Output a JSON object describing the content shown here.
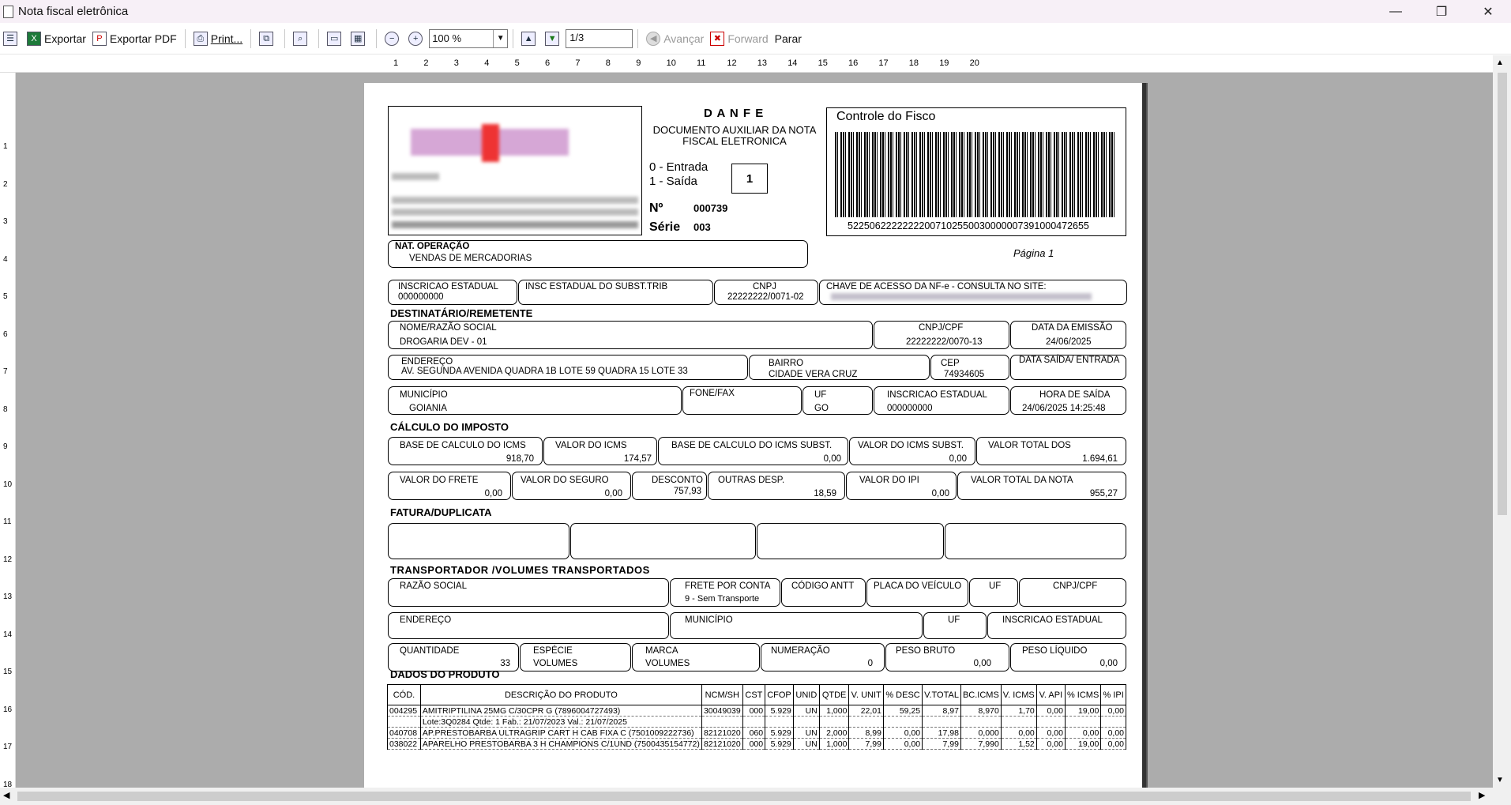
{
  "window": {
    "title": "Nota fiscal eletrônica",
    "min_glyph": "—",
    "max_glyph": "❐",
    "close_glyph": "✕"
  },
  "toolbar": {
    "export_label": "Exportar",
    "export_pdf_label": "Exportar PDF",
    "print_label": "Print...",
    "zoom_value": "100 %",
    "page_value": "1/3",
    "advance_label": "Avançar",
    "forward_label": "Forward",
    "stop_label": "Parar",
    "glyphs": {
      "toc": "☰",
      "xls": "X",
      "pdf": "P",
      "print": "⎙",
      "copy": "⧉",
      "find": "⌕",
      "single": "▭",
      "multi": "▦",
      "zoom_out": "−",
      "zoom_in": "+",
      "up": "▲",
      "down": "▼",
      "advance": "◀",
      "forward": "✖"
    }
  },
  "ruler": {
    "marks": [
      "1",
      "2",
      "3",
      "4",
      "5",
      "6",
      "7",
      "8",
      "9",
      "10",
      "11",
      "12",
      "13",
      "14",
      "15",
      "16",
      "17",
      "18",
      "19",
      "20"
    ],
    "vmarks": [
      "1",
      "2",
      "3",
      "4",
      "5",
      "6",
      "7",
      "8",
      "9",
      "10",
      "11",
      "12",
      "13",
      "14",
      "15",
      "16",
      "17",
      "18"
    ]
  },
  "danfe": {
    "title": "D A N F E",
    "subtitle": "DOCUMENTO AUXILIAR DA NOTA FISCAL ELETRONICA",
    "entrada": "0 - Entrada",
    "saida": "1 - Saída",
    "tipo": "1",
    "numero_label": "Nº",
    "numero": "000739",
    "serie_label": "Série",
    "serie": "003",
    "controle_fisco": "Controle do Fisco",
    "chave": "52250622222222007102550030000007391000472655",
    "pagina": "Página 1"
  },
  "header": {
    "nat_operacao_label": "NAT. OPERAÇÃO",
    "nat_operacao": "VENDAS DE MERCADORIAS",
    "ie_label": "INSCRICAO ESTADUAL",
    "ie": "000000000",
    "ie_st_label": "INSC ESTADUAL DO SUBST.TRIB",
    "cnpj_label": "CNPJ",
    "cnpj": "22222222/0071-02",
    "chave_label": "CHAVE DE ACESSO DA NF-e - CONSULTA NO SITE:"
  },
  "destinatario": {
    "section": "DESTINATÁRIO/REMETENTE",
    "nome_label": "NOME/RAZÃO SOCIAL",
    "nome": "DROGARIA DEV - 01",
    "cnpj_label": "CNPJ/CPF",
    "cnpj": "22222222/0070-13",
    "emissao_label": "DATA DA EMISSÃO",
    "emissao": "24/06/2025",
    "endereco_label": "ENDEREÇO",
    "endereco": "AV. SEGUNDA AVENIDA QUADRA 1B  LOTE 59 QUADRA 15 LOTE 33",
    "bairro_label": "BAIRRO",
    "bairro": "CIDADE VERA CRUZ",
    "cep_label": "CEP",
    "cep": "74934605",
    "saida_label": "DATA SAÍDA/ ENTRADA",
    "municipio_label": "MUNICÍPIO",
    "municipio": "GOIANIA",
    "fone_label": "FONE/FAX",
    "uf_label": "UF",
    "uf": "GO",
    "ie_label": "INSCRICAO ESTADUAL",
    "ie": "000000000",
    "hora_label": "HORA DE SAÍDA",
    "hora": "24/06/2025 14:25:48"
  },
  "imposto": {
    "section": "CÁLCULO DO IMPOSTO",
    "base_icms_label": "BASE DE CALCULO DO ICMS",
    "base_icms": "918,70",
    "valor_icms_label": "VALOR DO ICMS",
    "valor_icms": "174,57",
    "base_st_label": "BASE DE CALCULO DO ICMS SUBST.",
    "base_st": "0,00",
    "valor_st_label": "VALOR DO ICMS SUBST.",
    "valor_st": "0,00",
    "total_label": "VALOR TOTAL DOS",
    "total": "1.694,61",
    "frete_label": "VALOR DO FRETE",
    "frete": "0,00",
    "seguro_label": "VALOR DO SEGURO",
    "seguro": "0,00",
    "desconto_label": "DESCONTO",
    "desconto": "757,93",
    "outras_label": "OUTRAS DESP.",
    "outras": "18,59",
    "ipi_label": "VALOR DO IPI",
    "ipi": "0,00",
    "total_nota_label": "VALOR TOTAL DA NOTA",
    "total_nota": "955,27"
  },
  "fatura": {
    "section": "FATURA/DUPLICATA"
  },
  "transporte": {
    "section": "TRANSPORTADOR /VOLUMES TRANSPORTADOS",
    "razao_label": "RAZÃO SOCIAL",
    "frete_label": "FRETE POR CONTA",
    "frete": "9 - Sem Transporte",
    "antt_label": "CÓDIGO ANTT",
    "placa_label": "PLACA DO VEÍCULO",
    "uf_label": "UF",
    "cnpj_label": "CNPJ/CPF",
    "endereco_label": "ENDEREÇO",
    "municipio_label": "MUNICÍPIO",
    "uf2_label": "UF",
    "ie_label": "INSCRICAO ESTADUAL",
    "quantidade_label": "QUANTIDADE",
    "quantidade": "33",
    "especie_label": "ESPÉCIE",
    "especie": "VOLUMES",
    "marca_label": "MARCA",
    "marca": "VOLUMES",
    "numeracao_label": "NUMERAÇÃO",
    "numeracao": "0",
    "peso_bruto_label": "PESO BRUTO",
    "peso_bruto": "0,00",
    "peso_liquido_label": "PESO LÍQUIDO",
    "peso_liquido": "0,00"
  },
  "produtos": {
    "section": "DADOS DO PRODUTO",
    "headers": [
      "CÓD.",
      "DESCRIÇÃO DO PRODUTO",
      "NCM/SH",
      "CST",
      "CFOP",
      "UNID",
      "QTDE",
      "V. UNIT",
      "% DESC",
      "V.TOTAL",
      "BC.ICMS",
      "V. ICMS",
      "V. API",
      "% ICMS",
      "% IPI"
    ],
    "rows": [
      [
        "004295",
        "AMITRIPTILINA 25MG C/30CPR G (7896004727493)",
        "30049039",
        "000",
        "5.929",
        "UN",
        "1,000",
        "22,01",
        "59,25",
        "8,97",
        "8,970",
        "1,70",
        "0,00",
        "19,00",
        "0,00"
      ],
      [
        "",
        "Lote:3Q0284  Qtde: 1  Fab.: 21/07/2023  Val.: 21/07/2025",
        "",
        "",
        "",
        "",
        "",
        "",
        "",
        "",
        "",
        "",
        "",
        "",
        ""
      ],
      [
        "040708",
        "AP.PRESTOBARBA ULTRAGRIP CART H CAB FIXA C (7501009222736)",
        "82121020",
        "060",
        "5.929",
        "UN",
        "2,000",
        "8,99",
        "0,00",
        "17,98",
        "0,000",
        "0,00",
        "0,00",
        "0,00",
        "0,00"
      ],
      [
        "038022",
        "APARELHO PRESTOBARBA 3 H CHAMPIONS C/1UND (7500435154772)",
        "82121020",
        "000",
        "5.929",
        "UN",
        "1,000",
        "7,99",
        "0,00",
        "7,99",
        "7,990",
        "1,52",
        "0,00",
        "19,00",
        "0,00"
      ]
    ]
  }
}
